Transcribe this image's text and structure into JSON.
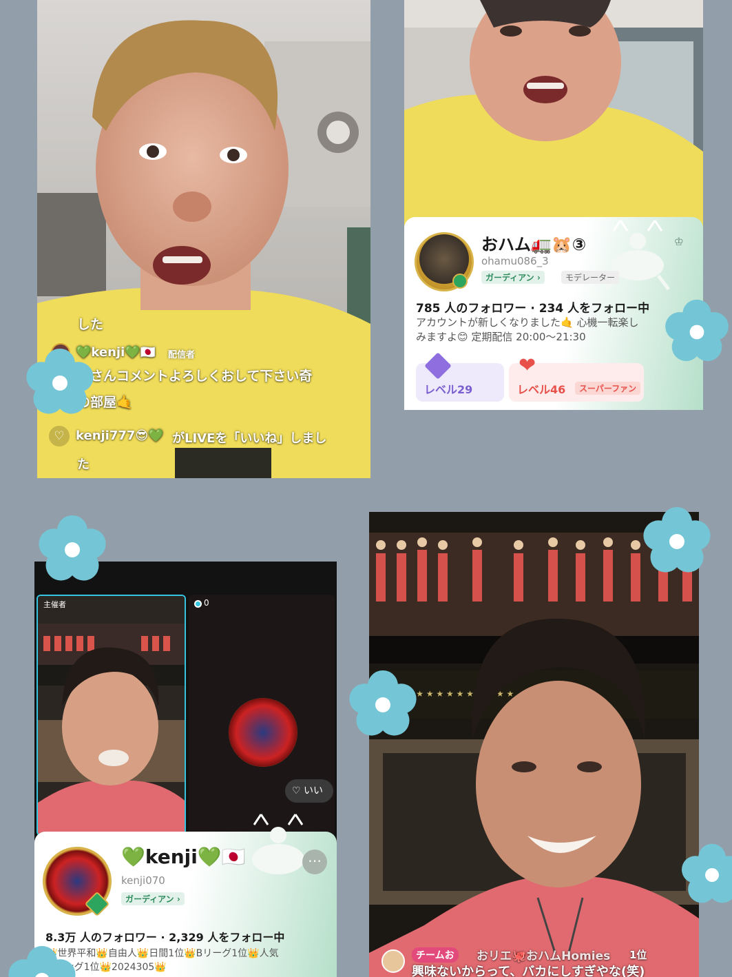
{
  "top_left": {
    "comments": [
      {
        "text": "した"
      },
      {
        "user": "💚kenji💚🇯🇵",
        "badge": "配信者",
        "text": "見さんコメントよろしくおして下さい奇",
        "text2": "の部屋🤙"
      },
      {
        "user": "kenji777😎💚",
        "text": "がLIVEを「いいね」しまし",
        "text2": "た"
      }
    ]
  },
  "top_right_profile": {
    "display_name": "おハム🚛🐹③",
    "username": "ohamu086_3",
    "role_guardian": "ガーディアン ›",
    "role_moderator": "モデレーター",
    "stats": "785 人のフォロワー · 234 人をフォロー中",
    "bio_line1": "アカウントが新しくなりました🤙 心機一転楽し",
    "bio_line2": "みますよ😊 定期配信 20:00〜21:30",
    "level_user": "レベル29",
    "level_fan": "レベル46",
    "fan_badge": "スーパーファン"
  },
  "bottom_left": {
    "host_label": "主催者",
    "viewer_count": "0",
    "like_label": "いい",
    "profile": {
      "display_name": "💚kenji💚🇯🇵",
      "username": "kenji070",
      "role_guardian": "ガーディアン ›",
      "more_icon": "more-icon",
      "stats": "8.3万 人のフォロワー · 2,329 人をフォロー中",
      "bio_line1": "👑世界平和👑自由人👑日間1位👑Bリーグ1位👑人気",
      "bio_line2": "ンキング1位👑2024305👑"
    }
  },
  "bottom_right": {
    "team_tag": "チームお",
    "team_names": "おリエ🐙おハムHomies",
    "rank": "1位",
    "comment": "興味ないからって、バカにしすぎやな(笑)"
  },
  "colors": {
    "background": "#929fab",
    "flower": "#74c6d7",
    "flower_center": "#ffffff",
    "tshirt_yellow": "#efdc5a",
    "tshirt_red": "#e06a6f",
    "guardian_green": "#3a9d6e",
    "level_purple": "#8f6fe0",
    "level_red": "#e8504a"
  }
}
